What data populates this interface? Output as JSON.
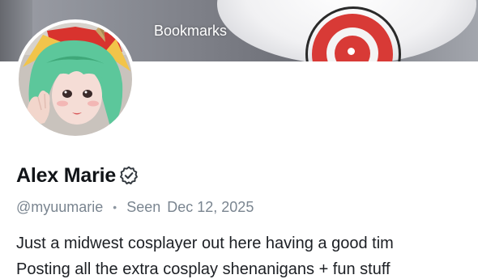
{
  "banner": {
    "bookmarks_label": "Bookmarks"
  },
  "profile": {
    "display_name": "Alex Marie",
    "verified_icon": "verified-badge-icon",
    "handle": "@myuumarie",
    "separator": "•",
    "seen_label": "Seen",
    "seen_date": "Dec 12, 2025",
    "bio_line1": "Just a midwest cosplayer out here having a good tim",
    "bio_line2": "Posting all the extra cosplay shenanigans + fun stuff"
  },
  "colors": {
    "banner_gray": "#8a8d95",
    "target_red": "#d83a36",
    "hair_green": "#5cc79b",
    "name_text": "#111418",
    "meta_text": "#7a8590"
  }
}
